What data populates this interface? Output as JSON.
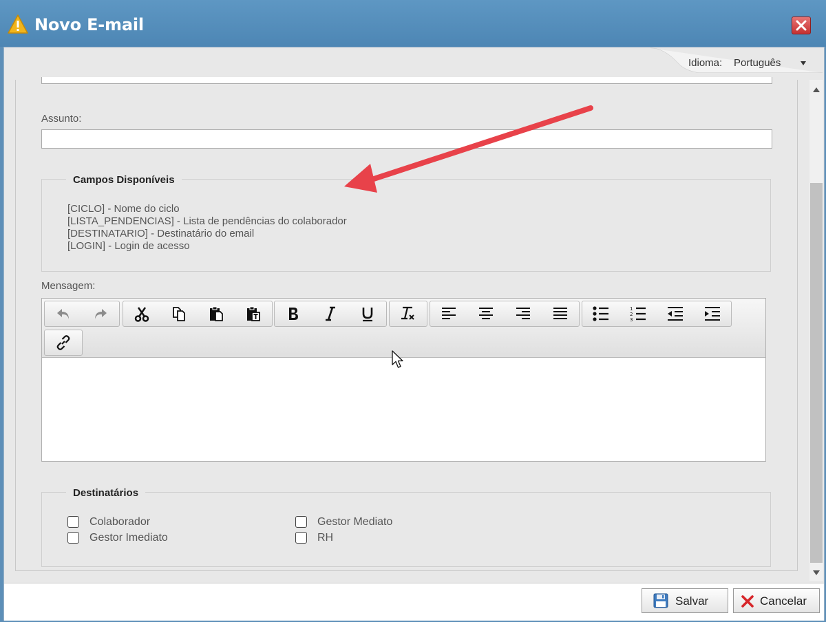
{
  "window": {
    "title": "Novo E-mail"
  },
  "language": {
    "label": "Idioma:",
    "value": "Português"
  },
  "subject": {
    "label": "Assunto:",
    "value": ""
  },
  "available_fields": {
    "legend": "Campos Disponíveis",
    "items": [
      "[CICLO] - Nome do ciclo",
      "[LISTA_PENDENCIAS] - Lista de pendências do colaborador",
      "[DESTINATARIO] - Destinatário do email",
      "[LOGIN] - Login de acesso"
    ]
  },
  "message": {
    "label": "Mensagem:",
    "body": ""
  },
  "recipients": {
    "legend": "Destinatários",
    "options": [
      "Colaborador",
      "Gestor Imediato",
      "Gestor Mediato",
      "RH"
    ]
  },
  "footer": {
    "save_label": "Salvar",
    "cancel_label": "Cancelar"
  },
  "colors": {
    "titlebar": "#5e97c3",
    "arrow": "#e8424a",
    "panel": "#e8e8e8"
  }
}
